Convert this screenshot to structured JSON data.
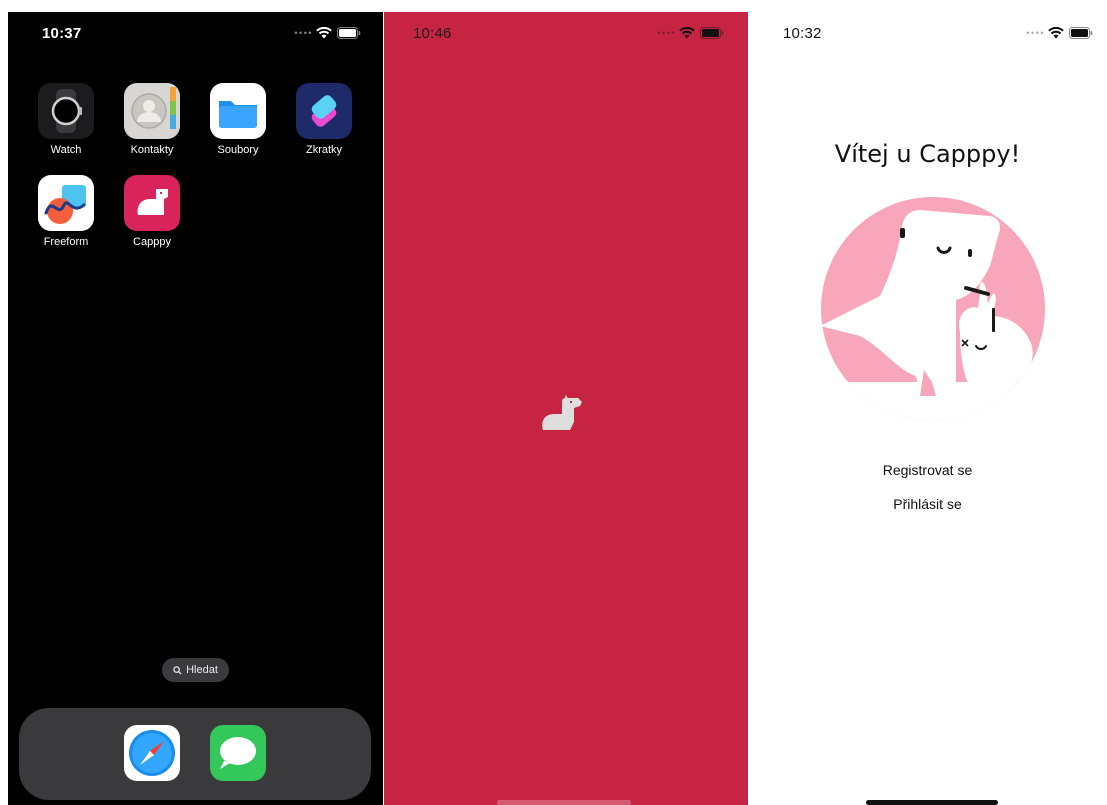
{
  "screens": [
    {
      "status": {
        "time": "10:37"
      },
      "apps": [
        {
          "label": "Watch"
        },
        {
          "label": "Kontakty"
        },
        {
          "label": "Soubory"
        },
        {
          "label": "Zkratky"
        },
        {
          "label": "Freeform"
        },
        {
          "label": "Capppy"
        }
      ],
      "search": {
        "label": "Hledat"
      },
      "dock": [
        "safari-icon",
        "messages-icon"
      ]
    },
    {
      "status": {
        "time": "10:46"
      },
      "splash": {
        "icon": "capybara-logo-icon"
      }
    },
    {
      "status": {
        "time": "10:32"
      },
      "welcome": {
        "title": "Vítej u Capppy!",
        "register_label": "Registrovat se",
        "login_label": "Přihlásit se"
      }
    }
  ],
  "colors": {
    "splash_bg": "#c72444",
    "illustration_pink": "#f7a6bb",
    "capppy_icon": "#d8245a"
  }
}
